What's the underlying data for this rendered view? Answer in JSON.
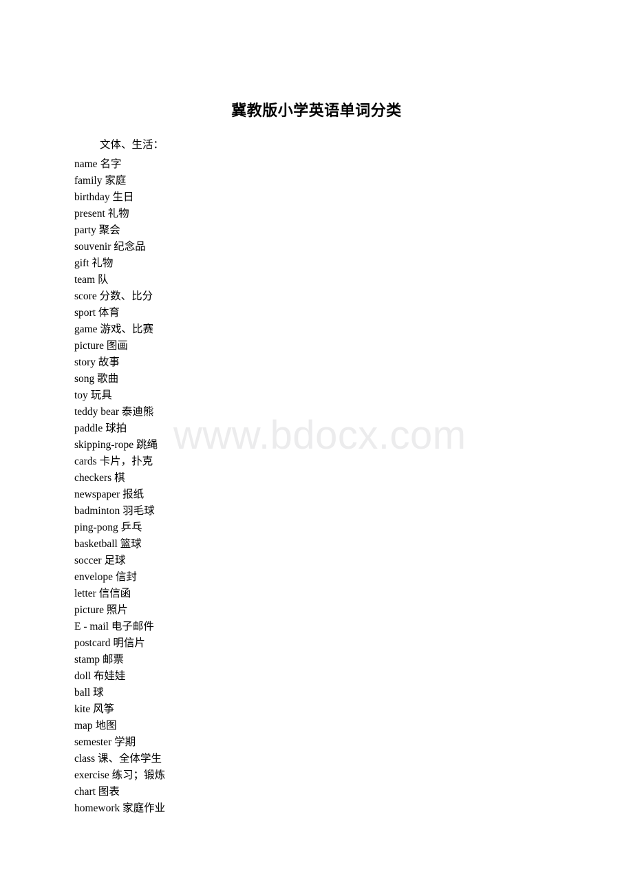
{
  "document": {
    "title": "冀教版小学英语单词分类",
    "watermark": "www.bdocx.com",
    "section": {
      "heading": "文体、生活："
    },
    "entries": [
      {
        "term": "name",
        "gloss": "名字"
      },
      {
        "term": "family",
        "gloss": "家庭"
      },
      {
        "term": "birthday",
        "gloss": "生日"
      },
      {
        "term": "present",
        "gloss": "礼物"
      },
      {
        "term": "party",
        "gloss": "聚会"
      },
      {
        "term": "souvenir",
        "gloss": "纪念品"
      },
      {
        "term": "gift",
        "gloss": "礼物"
      },
      {
        "term": "team",
        "gloss": "队"
      },
      {
        "term": "score",
        "gloss": "分数、比分"
      },
      {
        "term": "sport",
        "gloss": "体育"
      },
      {
        "term": "game",
        "gloss": "游戏、比赛"
      },
      {
        "term": "picture",
        "gloss": "图画"
      },
      {
        "term": "story",
        "gloss": "故事"
      },
      {
        "term": "song",
        "gloss": "歌曲"
      },
      {
        "term": "toy",
        "gloss": "玩具"
      },
      {
        "term": "teddy bear",
        "gloss": "泰迪熊"
      },
      {
        "term": "paddle",
        "gloss": "球拍"
      },
      {
        "term": "skipping-rope",
        "gloss": "跳绳"
      },
      {
        "term": "cards",
        "gloss": "卡片，扑克"
      },
      {
        "term": "checkers",
        "gloss": "棋"
      },
      {
        "term": "newspaper",
        "gloss": "报纸"
      },
      {
        "term": "badminton",
        "gloss": "羽毛球"
      },
      {
        "term": "ping-pong",
        "gloss": "乒乓"
      },
      {
        "term": "basketball",
        "gloss": "篮球"
      },
      {
        "term": "soccer",
        "gloss": "足球"
      },
      {
        "term": "envelope",
        "gloss": "信封"
      },
      {
        "term": "letter",
        "gloss": "信信函"
      },
      {
        "term": "picture",
        "gloss": "照片"
      },
      {
        "term": "E - mail",
        "gloss": "电子邮件"
      },
      {
        "term": "postcard",
        "gloss": "明信片"
      },
      {
        "term": "stamp",
        "gloss": "邮票"
      },
      {
        "term": "doll",
        "gloss": "布娃娃"
      },
      {
        "term": "ball",
        "gloss": "球"
      },
      {
        "term": "kite",
        "gloss": "风筝"
      },
      {
        "term": "map",
        "gloss": "地图"
      },
      {
        "term": "semester",
        "gloss": "学期"
      },
      {
        "term": "class",
        "gloss": "课、全体学生"
      },
      {
        "term": "exercise",
        "gloss": "练习；锻炼"
      },
      {
        "term": "chart",
        "gloss": "图表"
      },
      {
        "term": "homework",
        "gloss": "家庭作业"
      }
    ]
  }
}
